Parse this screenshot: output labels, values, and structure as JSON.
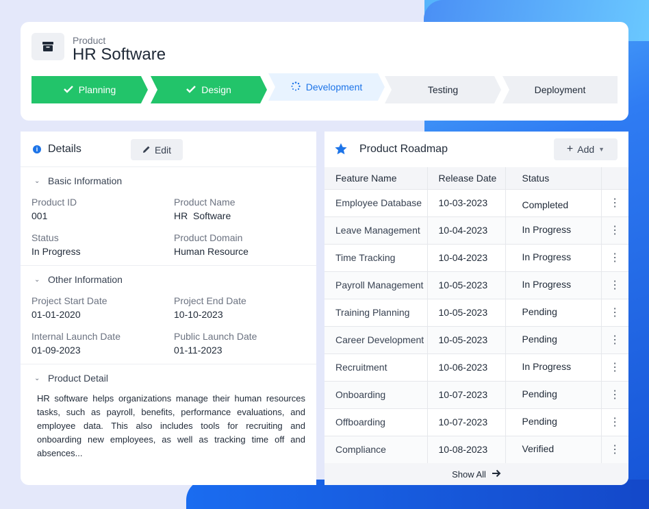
{
  "header": {
    "subtitle": "Product",
    "title": "HR Software",
    "steps": [
      {
        "label": "Planning",
        "state": "done"
      },
      {
        "label": "Design",
        "state": "done"
      },
      {
        "label": "Development",
        "state": "active"
      },
      {
        "label": "Testing",
        "state": "todo"
      },
      {
        "label": "Deployment",
        "state": "todo"
      }
    ]
  },
  "details": {
    "title": "Details",
    "edit_label": "Edit",
    "basic": {
      "heading": "Basic Information",
      "product_id_label": "Product ID",
      "product_id": "001",
      "product_name_label": "Product Name",
      "product_name": "HR  Software",
      "status_label": "Status",
      "status": "In Progress",
      "domain_label": "Product Domain",
      "domain": "Human Resource"
    },
    "other": {
      "heading": "Other Information",
      "start_label": "Project Start Date",
      "start": "01-01-2020",
      "end_label": "Project End Date",
      "end": "10-10-2023",
      "internal_label": "Internal Launch Date",
      "internal": "01-09-2023",
      "public_label": "Public Launch Date",
      "public": "01-11-2023"
    },
    "product_detail": {
      "heading": "Product Detail",
      "text": "HR software helps organizations manage their human resources tasks, such as payroll, benefits, performance evaluations, and employee data. This also includes tools for recruiting and onboarding new employees, as well as tracking time off and absences..."
    }
  },
  "roadmap": {
    "title": "Product Roadmap",
    "add_label": "Add",
    "columns": [
      "Feature Name",
      "Release Date",
      "Status"
    ],
    "rows": [
      {
        "feature": "Employee Database",
        "date": "10-03-2023",
        "status": "Completed"
      },
      {
        "feature": "Leave Management",
        "date": "10-04-2023",
        "status": "In Progress"
      },
      {
        "feature": "Time Tracking",
        "date": "10-04-2023",
        "status": "In Progress"
      },
      {
        "feature": "Payroll Management",
        "date": "10-05-2023",
        "status": "In Progress"
      },
      {
        "feature": "Training Planning",
        "date": "10-05-2023",
        "status": "Pending"
      },
      {
        "feature": "Career Development",
        "date": "10-05-2023",
        "status": "Pending"
      },
      {
        "feature": "Recruitment",
        "date": "10-06-2023",
        "status": "In Progress"
      },
      {
        "feature": "Onboarding",
        "date": "10-07-2023",
        "status": "Pending"
      },
      {
        "feature": "Offboarding",
        "date": "10-07-2023",
        "status": "Pending"
      },
      {
        "feature": "Compliance",
        "date": "10-08-2023",
        "status": "Verified"
      }
    ],
    "show_all_label": "Show All"
  },
  "colors": {
    "done": "#22c46a",
    "active": "#1d74e8",
    "accent_blue": "#1d74e8"
  }
}
